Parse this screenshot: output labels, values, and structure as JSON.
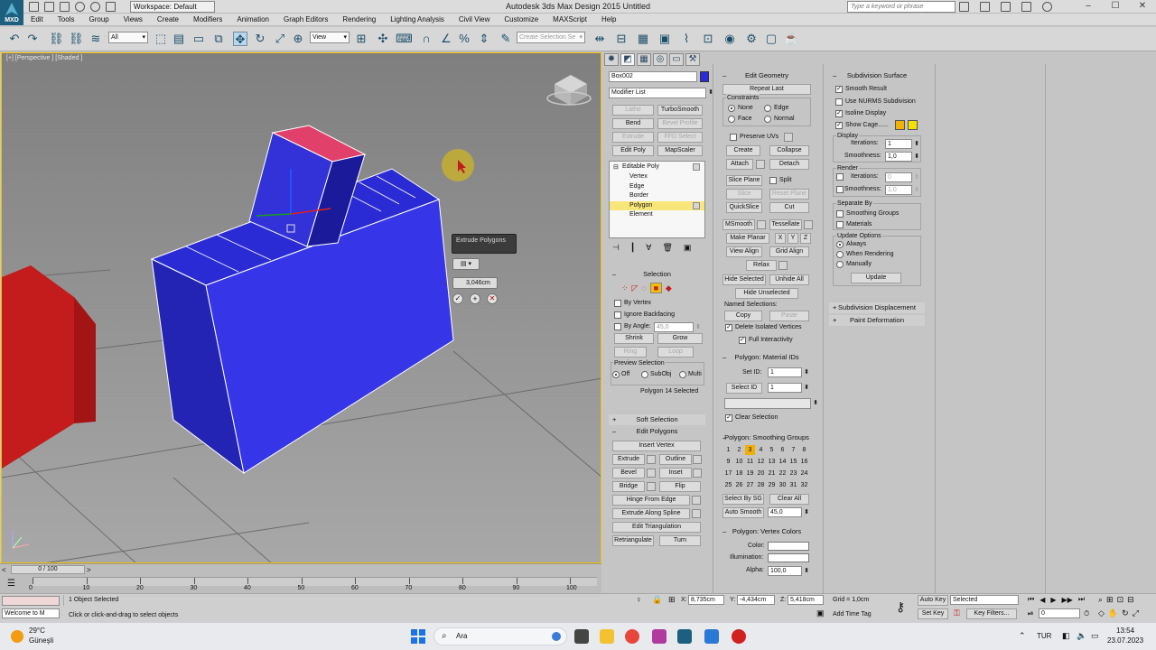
{
  "titlebar": {
    "logo_text": "MXD",
    "workspace": "Workspace: Default",
    "title": "Autodesk 3ds Max Design 2015     Untitled",
    "search_placeholder": "Type a keyword or phrase"
  },
  "menu": [
    "Edit",
    "Tools",
    "Group",
    "Views",
    "Create",
    "Modifiers",
    "Animation",
    "Graph Editors",
    "Rendering",
    "Lighting Analysis",
    "Civil View",
    "Customize",
    "MAXScript",
    "Help"
  ],
  "toolbar": {
    "selection_filter": "All",
    "ref_coord": "View",
    "named_selection_placeholder": "Create Selection Se"
  },
  "viewport": {
    "label": "[+] [Perspective ] [Shaded ]",
    "caddy_title": "Extrude Polygons",
    "caddy_value": "3,046cm"
  },
  "command_panel": {
    "object_name": "Box002",
    "object_color": "#2b2bd9",
    "modifier_list": "Modifier List",
    "mod_buttons": [
      [
        "Lathe",
        "TurboSmooth"
      ],
      [
        "Bend",
        "Bevel Profile"
      ],
      [
        "Extrude",
        "FFD Select"
      ],
      [
        "Edit Poly",
        "MapScaler"
      ]
    ],
    "stack": {
      "root": "Editable Poly",
      "items": [
        "Vertex",
        "Edge",
        "Border",
        "Polygon",
        "Element"
      ],
      "selected": "Polygon"
    },
    "selection": {
      "title": "Selection",
      "by_vertex": "By Vertex",
      "ignore_backfacing": "Ignore Backfacing",
      "by_angle": "By Angle:",
      "angle_value": "45,0",
      "shrink": "Shrink",
      "grow": "Grow",
      "ring": "Ring",
      "loop": "Loop",
      "preview_title": "Preview Selection",
      "preview_options": [
        "Off",
        "SubObj",
        "Multi"
      ],
      "status": "Polygon 14 Selected"
    },
    "soft_selection": "Soft Selection",
    "edit_polygons": {
      "title": "Edit Polygons",
      "insert_vertex": "Insert Vertex",
      "extrude": "Extrude",
      "outline": "Outline",
      "bevel": "Bevel",
      "inset": "Inset",
      "bridge": "Bridge",
      "flip": "Flip",
      "hinge": "Hinge From Edge",
      "extrude_spline": "Extrude Along Spline",
      "edit_tri": "Edit Triangulation",
      "retriangulate": "Retriangulate",
      "turn": "Turn"
    },
    "edit_geometry": {
      "title": "Edit Geometry",
      "repeat_last": "Repeat Last",
      "constraints": "Constraints",
      "constraint_options": [
        "None",
        "Edge",
        "Face",
        "Normal"
      ],
      "preserve_uvs": "Preserve UVs",
      "create": "Create",
      "collapse": "Collapse",
      "attach": "Attach",
      "detach": "Detach",
      "slice_plane": "Slice Plane",
      "split": "Split",
      "slice": "Slice",
      "reset_plane": "Reset Plane",
      "quickslice": "QuickSlice",
      "cut": "Cut",
      "msmooth": "MSmooth",
      "tessellate": "Tessellate",
      "make_planar": "Make Planar",
      "x": "X",
      "y": "Y",
      "z": "Z",
      "view_align": "View Align",
      "grid_align": "Grid Align",
      "relax": "Relax",
      "hide_selected": "Hide Selected",
      "unhide_all": "Unhide All",
      "hide_unselected": "Hide Unselected",
      "named_selections": "Named Selections:",
      "copy": "Copy",
      "paste": "Paste",
      "delete_isolated": "Delete Isolated Vertices",
      "full_interactivity": "Full Interactivity"
    },
    "material_ids": {
      "title": "Polygon: Material IDs",
      "set_id": "Set ID:",
      "set_id_value": "1",
      "select_id": "Select ID",
      "select_id_value": "1",
      "clear_selection": "Clear Selection"
    },
    "smoothing_groups": {
      "title": "Polygon: Smoothing Groups",
      "numbers": [
        "1",
        "2",
        "3",
        "4",
        "5",
        "6",
        "7",
        "8",
        "9",
        "10",
        "11",
        "12",
        "13",
        "14",
        "15",
        "16",
        "17",
        "18",
        "19",
        "20",
        "21",
        "22",
        "23",
        "24",
        "25",
        "26",
        "27",
        "28",
        "29",
        "30",
        "31",
        "32"
      ],
      "active": "3",
      "select_by_sg": "Select By SG",
      "clear_all": "Clear All",
      "auto_smooth": "Auto Smooth",
      "auto_smooth_value": "45,0"
    },
    "vertex_colors": {
      "title": "Polygon: Vertex Colors",
      "color": "Color:",
      "illumination": "Illumination:",
      "alpha": "Alpha:",
      "alpha_value": "100,0"
    },
    "subdivision": {
      "title": "Subdivision Surface",
      "smooth_result": "Smooth Result",
      "use_nurms": "Use NURMS Subdivision",
      "isoline": "Isoline Display",
      "show_cage": "Show Cage......",
      "display": "Display",
      "iterations": "Iterations:",
      "iterations_value": "1",
      "smoothness": "Smoothness:",
      "smoothness_value": "1,0",
      "render": "Render",
      "render_iterations_value": "0",
      "render_smoothness_value": "1,0",
      "separate_by": "Separate By",
      "smoothing_groups": "Smoothing Groups",
      "materials": "Materials",
      "update_options": "Update Options",
      "update_choices": [
        "Always",
        "When Rendering",
        "Manually"
      ],
      "update": "Update",
      "cage_color_1": "#f0b400",
      "cage_color_2": "#f5e000"
    },
    "subdivision_displacement": "Subdivision Displacement",
    "paint_deformation": "Paint Deformation"
  },
  "timeline": {
    "frame": "0 / 100",
    "ticks": [
      "0",
      "10",
      "20",
      "30",
      "40",
      "50",
      "60",
      "70",
      "80",
      "90",
      "100"
    ]
  },
  "status": {
    "objects_selected": "1 Object Selected",
    "prompt": "Click or click-and-drag to select objects",
    "listener": "Welcome to M",
    "x_label": "X:",
    "x_value": "8,735cm",
    "y_label": "Y:",
    "y_value": "-4,434cm",
    "z_label": "Z:",
    "z_value": "5,418cm",
    "grid": "Grid = 1,0cm",
    "add_time_tag": "Add Time Tag",
    "auto_key": "Auto Key",
    "set_key": "Set Key",
    "key_mode": "Selected",
    "key_filters": "Key Filters...",
    "frame_value": "0"
  },
  "taskbar": {
    "weather_temp": "29°C",
    "weather_text": "Güneşli",
    "search": "Ara",
    "lang": "TUR",
    "time": "13:54",
    "date": "23.07.2023"
  }
}
